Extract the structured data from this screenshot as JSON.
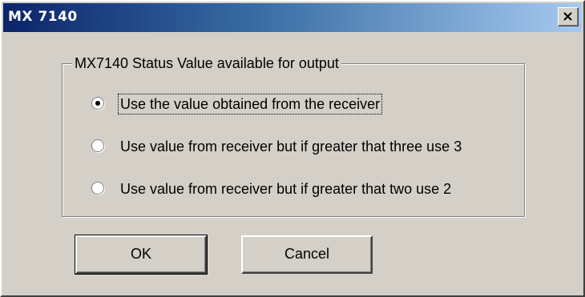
{
  "window": {
    "title": "MX 7140",
    "close_icon": "close-x-icon"
  },
  "group": {
    "legend": "MX7140 Status Value available for output",
    "options": [
      {
        "label": "Use the value obtained from the receiver",
        "selected": true
      },
      {
        "label": "Use value from receiver but if greater that three use 3",
        "selected": false
      },
      {
        "label": "Use value from receiver but if greater that two use 2",
        "selected": false
      }
    ]
  },
  "buttons": {
    "ok_label": "OK",
    "cancel_label": "Cancel"
  },
  "colors": {
    "face": "#d4d0c8",
    "title_start": "#0a246a",
    "title_end": "#a6caf0"
  }
}
